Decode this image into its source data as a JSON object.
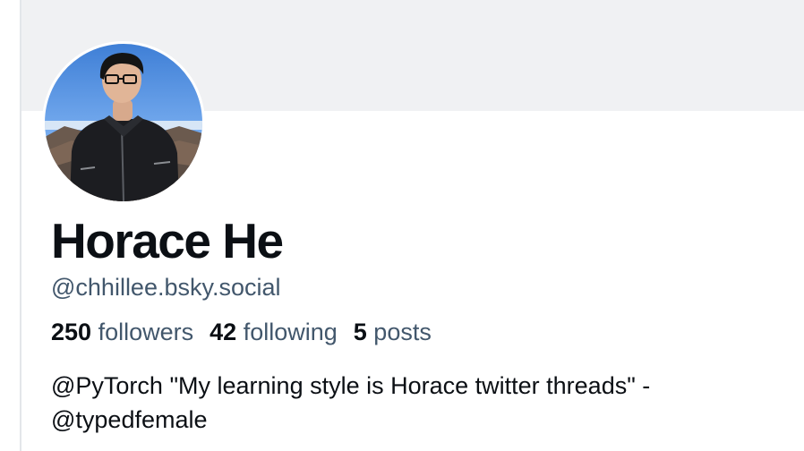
{
  "profile": {
    "display_name": "Horace He",
    "handle": "@chhillee.bsky.social",
    "stats": {
      "followers_count": "250",
      "followers_label": "followers",
      "following_count": "42",
      "following_label": "following",
      "posts_count": "5",
      "posts_label": "posts"
    },
    "bio": {
      "line1": "@PyTorch \"My learning style is Horace twitter threads\" -",
      "line2": "@typedfemale"
    },
    "avatar_icon": "profile-photo"
  },
  "colors": {
    "banner": "#f0f1f3",
    "text_primary": "#0b0f14",
    "text_secondary": "#42576c"
  }
}
